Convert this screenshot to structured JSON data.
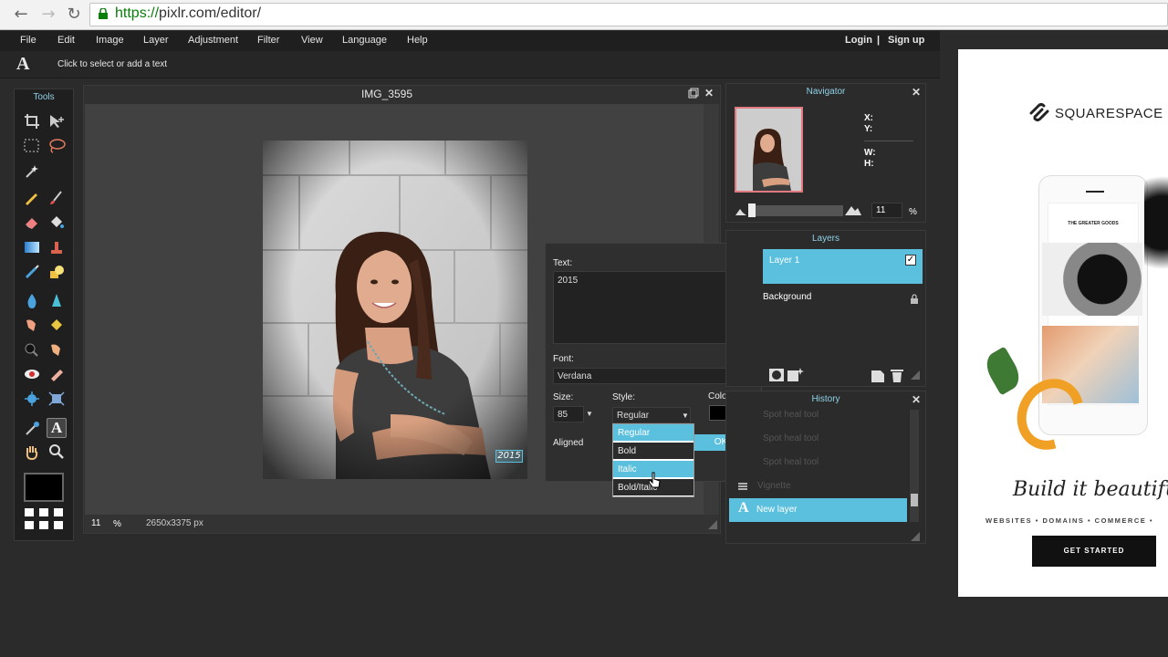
{
  "browser": {
    "url_protocol": "https://",
    "url_rest": "pixlr.com/editor/",
    "back_icon": "back-arrow-icon",
    "forward_icon": "forward-arrow-icon",
    "reload_icon": "reload-icon"
  },
  "menu": {
    "items": [
      "File",
      "Edit",
      "Image",
      "Layer",
      "Adjustment",
      "Filter",
      "View",
      "Language",
      "Help"
    ],
    "login": "Login",
    "separator": "|",
    "signup": "Sign up"
  },
  "options_bar": {
    "tool_glyph": "A",
    "hint": "Click to select or add a text"
  },
  "tools": {
    "title": "Tools",
    "text_tool_glyph": "A"
  },
  "canvas": {
    "title": "IMG_3595",
    "zoom": "11",
    "zoom_unit": "%",
    "dimensions": "2650x3375 px",
    "overlay_text": "2015"
  },
  "text_dialog": {
    "text_label": "Text:",
    "text_value": "2015",
    "font_label": "Font:",
    "font_value": "Verdana",
    "size_label": "Size:",
    "size_value": "85",
    "style_label": "Style:",
    "style_value": "Regular",
    "color_label": "Color:",
    "aligned_label": "Aligned",
    "ok_label": "OK",
    "style_options": [
      "Regular",
      "Bold",
      "Italic",
      "Bold/Italic"
    ],
    "highlighted_option": "Italic"
  },
  "navigator": {
    "title": "Navigator",
    "x_label": "X:",
    "y_label": "Y:",
    "w_label": "W:",
    "h_label": "H:",
    "zoom": "11",
    "zoom_unit": "%"
  },
  "layers": {
    "title": "Layers",
    "items": [
      {
        "name": "Layer 1",
        "selected": true
      },
      {
        "name": "Background",
        "selected": false
      }
    ]
  },
  "history": {
    "title": "History",
    "items": [
      "Spot heal tool",
      "Spot heal tool",
      "Spot heal tool",
      "Vignette"
    ],
    "selected": "New layer"
  },
  "ad": {
    "brand": "SQUARESPACE",
    "phone_heading": "THE GREATER GOODS",
    "script_line": "Build it beautiful",
    "services": "WEBSITES • DOMAINS • COMMERCE •",
    "cta": "GET STARTED"
  },
  "colors": {
    "accent": "#5bc0de",
    "panel_title": "#8ed2e6",
    "app_bg": "#2b2b2b",
    "text_color_swatch": "#000000"
  }
}
